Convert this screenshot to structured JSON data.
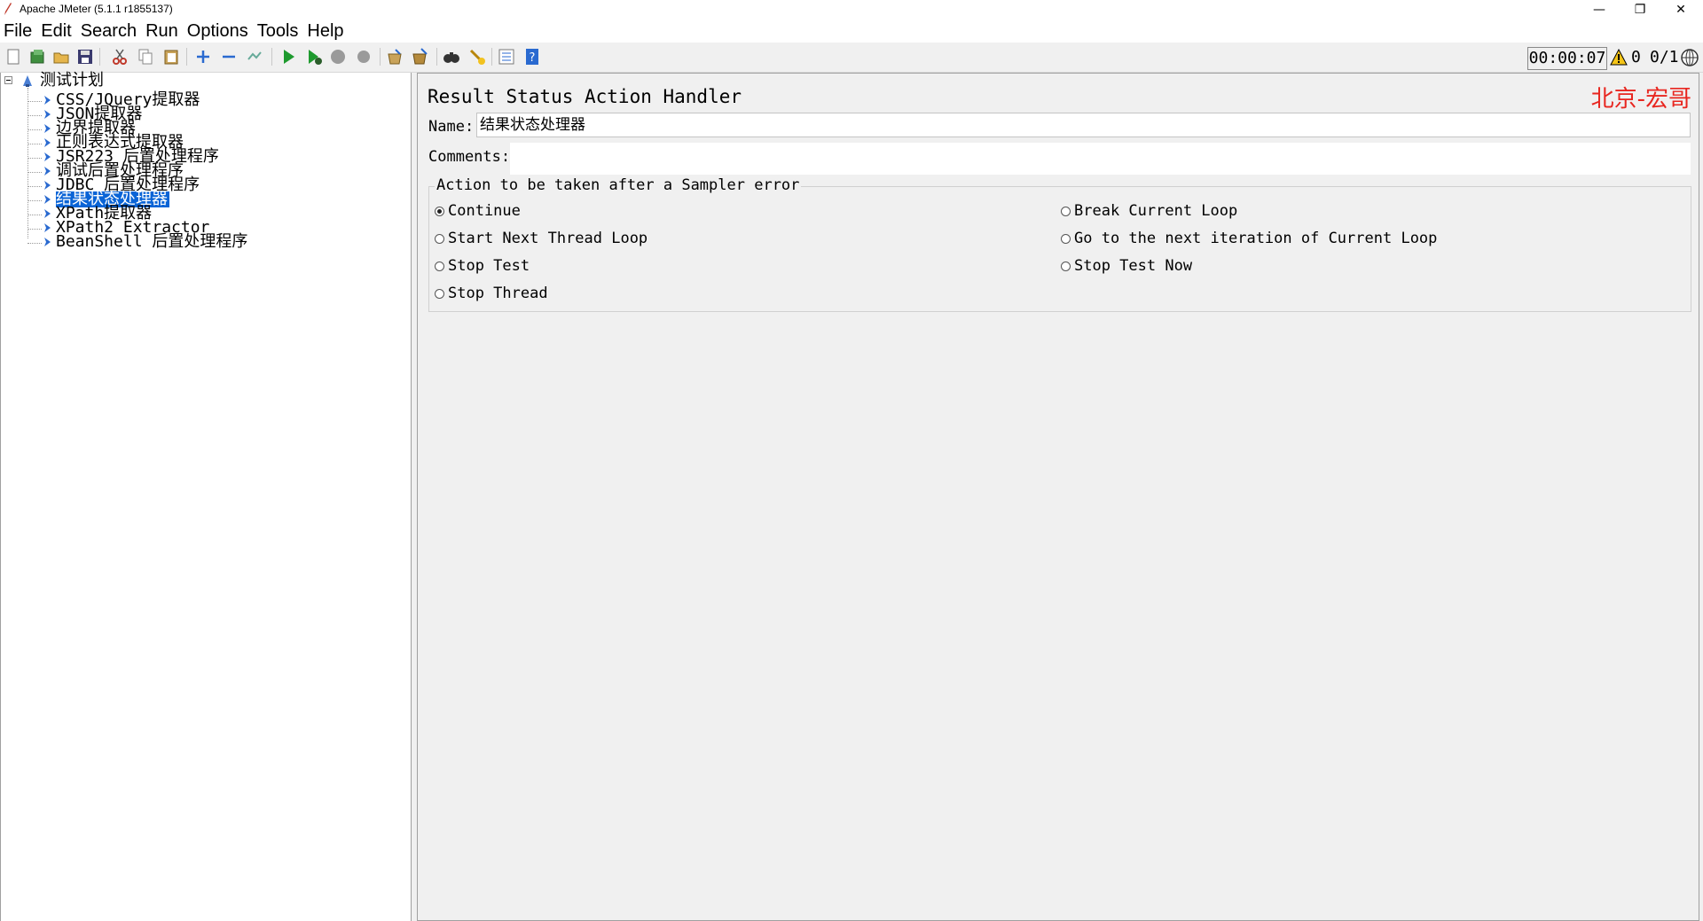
{
  "window": {
    "title": "Apache JMeter (5.1.1 r1855137)",
    "minimize_glyph": "—",
    "restore_glyph": "❐",
    "close_glyph": "✕"
  },
  "menu": [
    "File",
    "Edit",
    "Search",
    "Run",
    "Options",
    "Tools",
    "Help"
  ],
  "toolbar": {
    "icons": [
      "new-icon",
      "templates-icon",
      "open-icon",
      "save-icon",
      "cut-icon",
      "copy-icon",
      "paste-icon",
      "expand-icon",
      "collapse-icon",
      "toggle-icon",
      "start-icon",
      "start-no-pause-icon",
      "stop-icon",
      "shutdown-icon",
      "clear-icon",
      "clear-all-icon",
      "search-icon",
      "reset-search-icon",
      "function-helper-icon",
      "help-icon"
    ],
    "timer": "00:00:07",
    "warning_count": "0",
    "threads": "0/1"
  },
  "tree": {
    "root": "测试计划",
    "children": [
      "CSS/JQuery提取器",
      "JSON提取器",
      "边界提取器",
      "正则表达式提取器",
      "JSR223 后置处理程序",
      "调试后置处理程序",
      "JDBC 后置处理程序",
      "结果状态处理器",
      "XPath提取器",
      "XPath2 Extractor",
      "BeanShell 后置处理程序"
    ],
    "selected_index": 7
  },
  "editor": {
    "title": "Result Status Action Handler",
    "watermark": "北京-宏哥",
    "name_label": "Name:",
    "name_value": "结果状态处理器",
    "comments_label": "Comments:",
    "comments_value": "",
    "group_title": "Action to be taken after a Sampler error",
    "options": [
      {
        "label": "Continue",
        "checked": true
      },
      {
        "label": "Start Next Thread Loop",
        "checked": false
      },
      {
        "label": "Stop Test",
        "checked": false
      },
      {
        "label": "Stop Thread",
        "checked": false
      },
      {
        "label": "Break Current Loop",
        "checked": false
      },
      {
        "label": "Go to the next iteration of Current Loop",
        "checked": false
      },
      {
        "label": "Stop Test Now",
        "checked": false
      }
    ]
  }
}
